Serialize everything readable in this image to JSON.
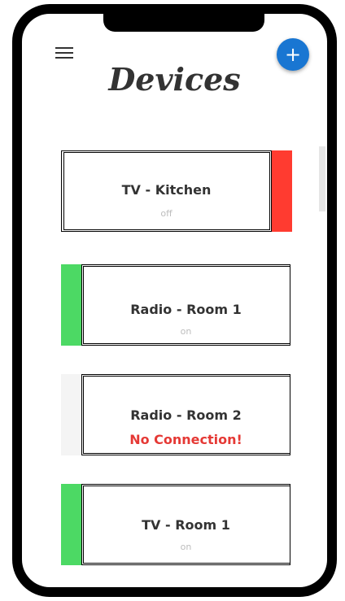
{
  "header": {
    "title": "Devices",
    "add_label": "+"
  },
  "colors": {
    "on": "#4cd964",
    "off": "#ff3b30",
    "no_connection": "#f4f4f4",
    "accent": "#1976d2",
    "error_text": "#e53935"
  },
  "devices": [
    {
      "name": "TV - Kitchen",
      "status": "off",
      "state": "off"
    },
    {
      "name": "Radio - Room 1",
      "status": "on",
      "state": "on"
    },
    {
      "name": "Radio - Room 2",
      "status": "No Connection!",
      "state": "no_connection"
    },
    {
      "name": "TV - Room 1",
      "status": "on",
      "state": "on"
    }
  ]
}
